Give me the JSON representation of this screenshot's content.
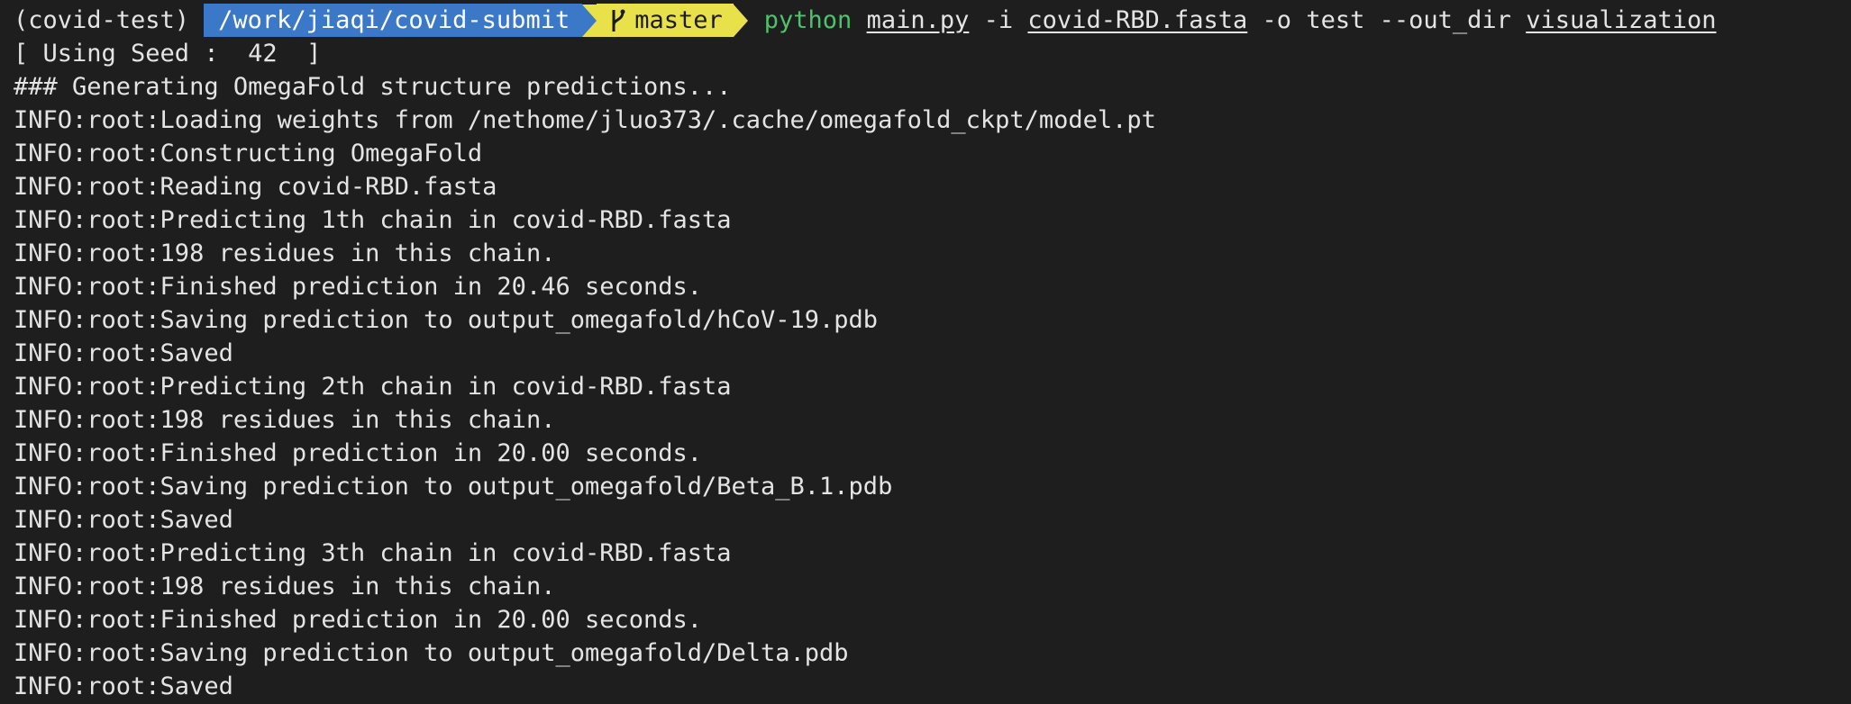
{
  "prompt": {
    "env": "(covid-test)",
    "directory": "/work/jiaqi/covid-submit",
    "branch": "master",
    "command": {
      "program": "python",
      "script": "main.py",
      "flag_i": "-i",
      "input_file": "covid-RBD.fasta",
      "flag_o": "-o",
      "output_name": "test",
      "flag_outdir": "--out_dir",
      "out_dir": "visualization"
    }
  },
  "output_lines": [
    "[ Using Seed :  42  ]",
    "### Generating OmegaFold structure predictions...",
    "INFO:root:Loading weights from /nethome/jluo373/.cache/omegafold_ckpt/model.pt",
    "INFO:root:Constructing OmegaFold",
    "INFO:root:Reading covid-RBD.fasta",
    "INFO:root:Predicting 1th chain in covid-RBD.fasta",
    "INFO:root:198 residues in this chain.",
    "INFO:root:Finished prediction in 20.46 seconds.",
    "INFO:root:Saving prediction to output_omegafold/hCoV-19.pdb",
    "INFO:root:Saved",
    "INFO:root:Predicting 2th chain in covid-RBD.fasta",
    "INFO:root:198 residues in this chain.",
    "INFO:root:Finished prediction in 20.00 seconds.",
    "INFO:root:Saving prediction to output_omegafold/Beta_B.1.pdb",
    "INFO:root:Saved",
    "INFO:root:Predicting 3th chain in covid-RBD.fasta",
    "INFO:root:198 residues in this chain.",
    "INFO:root:Finished prediction in 20.00 seconds.",
    "INFO:root:Saving prediction to output_omegafold/Delta.pdb",
    "INFO:root:Saved"
  ],
  "colors": {
    "background": "#1e1e1e",
    "text": "#e4e4e4",
    "dir_segment": "#3b78c8",
    "git_segment": "#e9e14a",
    "command": "#4ec26a"
  }
}
